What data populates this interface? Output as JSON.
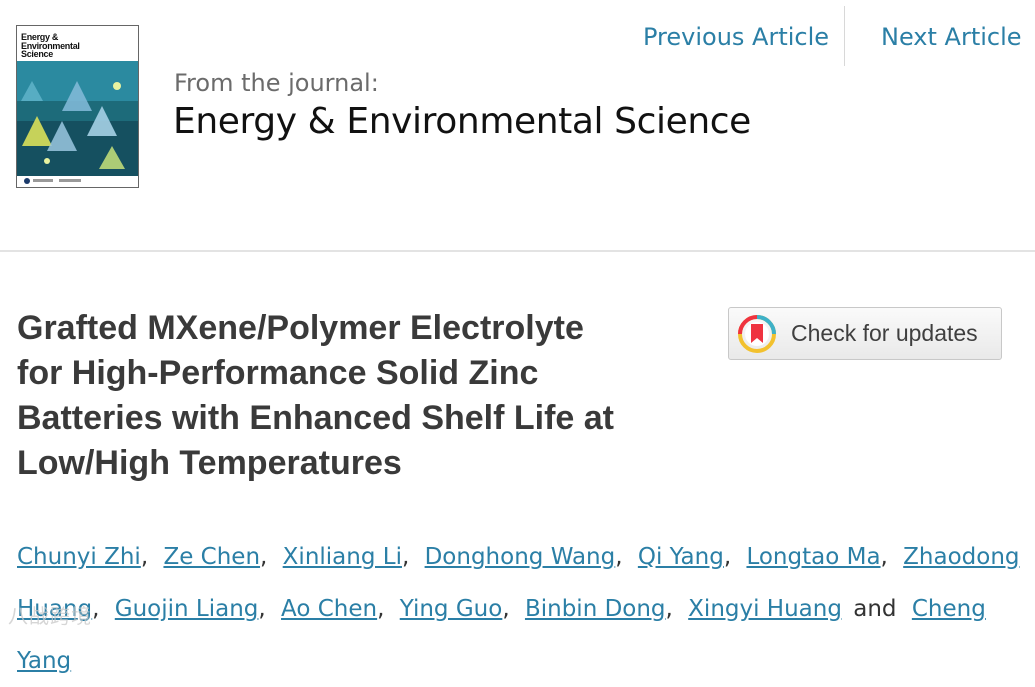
{
  "cover": {
    "title_lines": [
      "Energy &",
      "Environmental",
      "Science"
    ]
  },
  "journal": {
    "from_label": "From the journal:",
    "name": "Energy & Environmental Science"
  },
  "nav": {
    "previous": "Previous Article",
    "next": "Next Article"
  },
  "article": {
    "title_lines": [
      "Grafted MXene/Polymer Electrolyte",
      "for High-Performance Solid Zinc",
      "Batteries with Enhanced Shelf Life at",
      "Low/High Temperatures"
    ]
  },
  "check_updates": {
    "label": "Check for updates"
  },
  "authors": {
    "names": [
      "Chunyi Zhi",
      "Ze Chen",
      "Xinliang Li",
      "Donghong Wang",
      "Qi Yang",
      "Longtao Ma",
      "Zhaodong Huang",
      "Guojin Liang",
      "Ao Chen",
      "Ying Guo",
      "Binbin Dong",
      "Xingyi Huang",
      "Cheng Yang"
    ],
    "separator": ",",
    "conjunction": "and"
  },
  "watermark": {
    "text": "八战跨境"
  },
  "colors": {
    "link": "#2b7fa6",
    "title": "#3a3a3a",
    "journal_label": "#6b6b6b"
  }
}
